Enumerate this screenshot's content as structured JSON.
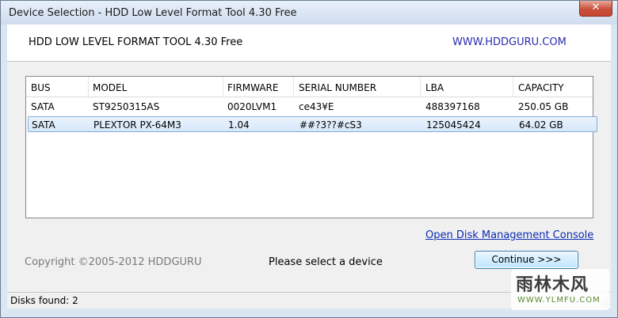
{
  "window": {
    "title": "Device Selection - HDD Low Level Format Tool 4.30   Free",
    "close_glyph": "✕"
  },
  "header": {
    "app_name": "HDD LOW LEVEL FORMAT TOOL 4.30    Free",
    "website": "WWW.HDDGURU.COM"
  },
  "disk_list": {
    "columns": [
      "BUS",
      "MODEL",
      "FIRMWARE",
      "SERIAL NUMBER",
      "LBA",
      "CAPACITY"
    ],
    "rows": [
      {
        "bus": "SATA",
        "model": "ST9250315AS",
        "firmware": "0020LVM1",
        "serial": "ce43¥E",
        "lba": "488397168",
        "capacity": "250.05 GB",
        "selected": false
      },
      {
        "bus": "SATA",
        "model": "PLEXTOR PX-64M3",
        "firmware": "1.04",
        "serial": "##?3??#cS3",
        "lba": "125045424",
        "capacity": "64.02 GB",
        "selected": true
      }
    ]
  },
  "actions": {
    "open_console": "Open Disk Management Console",
    "continue": "Continue >>>"
  },
  "footer": {
    "copyright": "Copyright ©2005-2012 HDDGURU",
    "prompt": "Please select a device"
  },
  "status": {
    "disks_found": "Disks found: 2"
  },
  "watermark": {
    "main": "雨林木风",
    "sub": "WWW.YLMFU.COM"
  }
}
